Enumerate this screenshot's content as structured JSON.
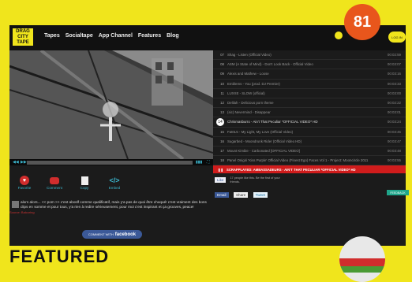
{
  "badge": "81",
  "header": {
    "logo": "DRAG CITY TAPE",
    "nav": [
      "Tapes",
      "Socialtape",
      "App Channel",
      "Features",
      "Blog"
    ],
    "signin": "LOG IN"
  },
  "playlist": [
    {
      "n": "07",
      "title": "Shag - Listen (Official Video)",
      "dur": "00:02:59"
    },
    {
      "n": "08",
      "title": "ASM (A State of Mind) - Don't Look Back - Official Video",
      "dur": "00:03:07"
    },
    {
      "n": "09",
      "title": "Alexis and Mathew - Loose",
      "dur": "00:03:16"
    },
    {
      "n": "10",
      "title": "Emblems - You (prod. DJ Premier)",
      "dur": "00:03:33"
    },
    {
      "n": "11",
      "title": "LUXXE - SLOW (official)",
      "dur": "00:03:00"
    },
    {
      "n": "12",
      "title": "Delilah - Delicious porn theme",
      "dur": "00:02:22"
    },
    {
      "n": "13",
      "title": "(sic) Nevermind - Disappear",
      "dur": "00:03:01"
    },
    {
      "n": "14",
      "title": "Chrismasburro - Ain't That Peculiar *OFFICIAL VIDEO* HD",
      "dur": "00:03:24"
    },
    {
      "n": "15",
      "title": "Fat0L5 - My Light, My Love (Official Video)",
      "dur": "00:03:45"
    },
    {
      "n": "16",
      "title": "Sugarbed - Moondrunk Rider (Official Video HD)",
      "dur": "00:03:47"
    },
    {
      "n": "17",
      "title": "Mount Kimbie - Carbonated [OFFICIAL VIDEO]",
      "dur": "00:03:48"
    },
    {
      "n": "18",
      "title": "Panel Onigiri 'Kiss Purple' Official Video (Finest Ego) Faces Vol 1 - Project: Mooncircle 2011",
      "dur": "00:03:55"
    }
  ],
  "now_playing": "SCRAPPLAYED: AMBASSADEURS - AIN'T THAT PECULIAR *OFFICIAL VIDEO* HD",
  "actions": [
    {
      "label": "Favorite",
      "icon": "heart-icon"
    },
    {
      "label": "Comment",
      "icon": "comment-icon"
    },
    {
      "label": "Copy",
      "icon": "copy-icon"
    },
    {
      "label": "Embed",
      "icon": "code-icon"
    }
  ],
  "social": {
    "like": "Like",
    "like_text": "17 people like this. Be the first of your friends.",
    "email": "Email",
    "share": "Share",
    "tweet": "Tweet"
  },
  "feedback": "FEEDBACK",
  "comment": {
    "text": "alors alors... << pom >> c'est aboslf comme qualificatif, mais y'a pas de quoi être choqué! c'est vraiment des bons clips en somme et pour tous, y'a rien à redire sérieusement, pour moi c'est inspirant et ça grooves, peace!",
    "source": "Source: Balcoring"
  },
  "fb_comment": {
    "prefix": "COMMENT WITH",
    "brand": "facebook"
  },
  "featured": "FEATURED"
}
